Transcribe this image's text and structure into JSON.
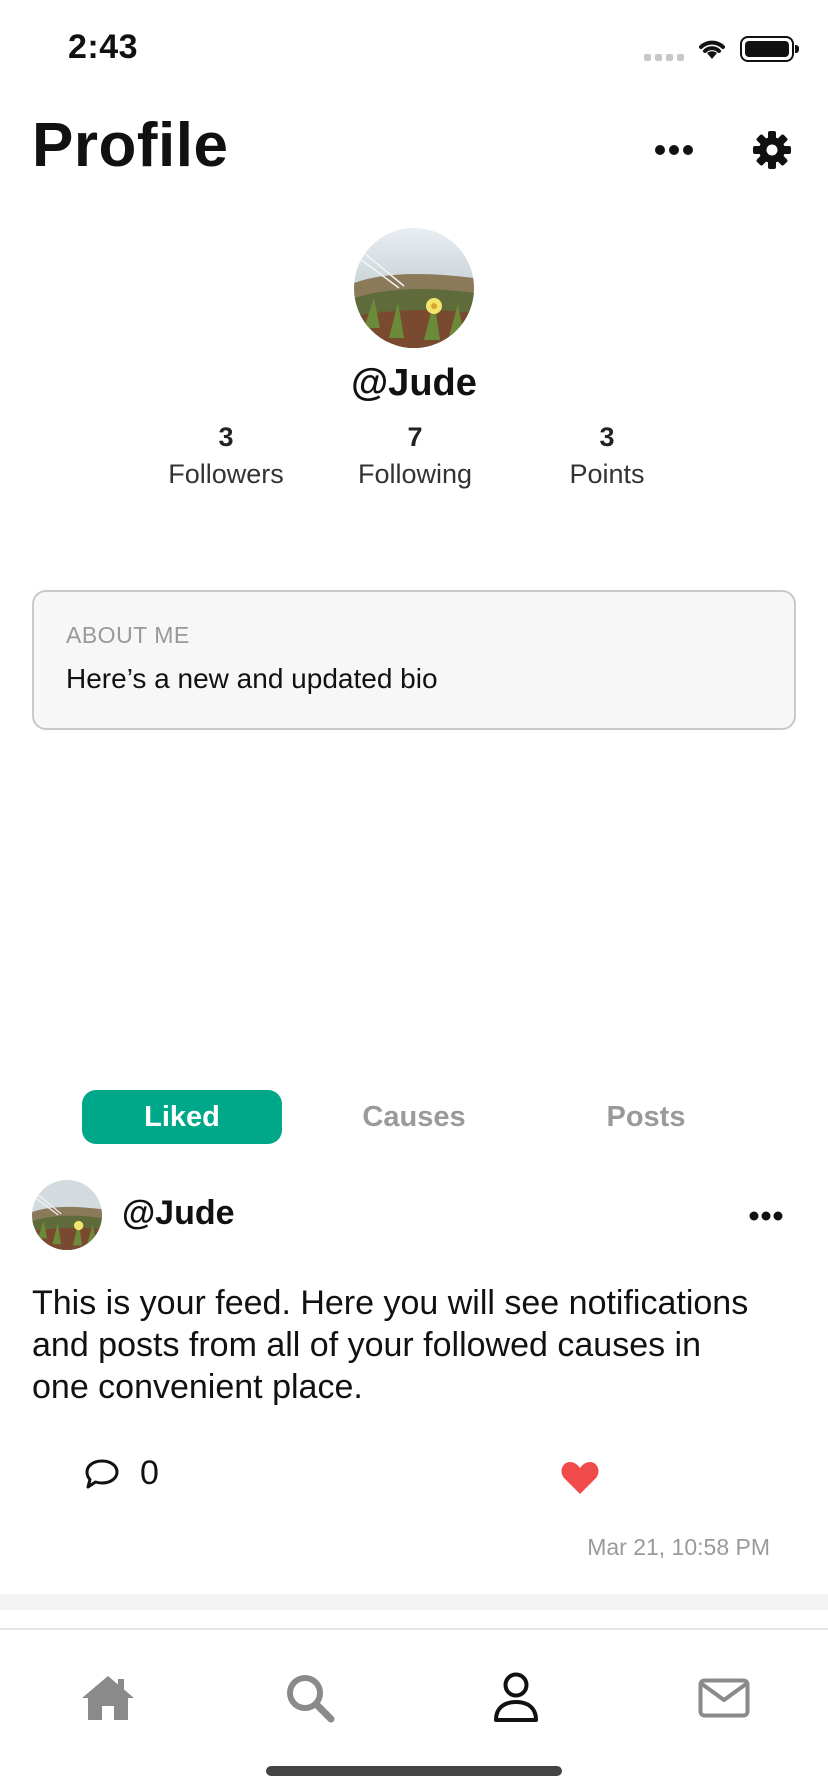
{
  "status_bar": {
    "time": "2:43"
  },
  "header": {
    "title": "Profile"
  },
  "profile": {
    "username": "@Jude",
    "stats": [
      {
        "value": "3",
        "label": "Followers"
      },
      {
        "value": "7",
        "label": "Following"
      },
      {
        "value": "3",
        "label": "Points"
      }
    ]
  },
  "about": {
    "title": "ABOUT ME",
    "text": "Here’s a new and updated bio"
  },
  "tabs": [
    {
      "label": "Liked",
      "active": true
    },
    {
      "label": "Causes",
      "active": false
    },
    {
      "label": "Posts",
      "active": false
    }
  ],
  "post": {
    "username": "@Jude",
    "body": "This is your feed. Here you will see notifications and posts from all of your followed causes in one convenient place.",
    "comment_count": "0",
    "liked": true,
    "timestamp": "Mar 21, 10:58 PM"
  },
  "colors": {
    "accent": "#00a88a",
    "like": "#f04a4a",
    "inactive_tab": "#9a9a9a"
  },
  "icons": {
    "header": [
      "more-icon",
      "gear-icon"
    ],
    "tab_bar": [
      "home-icon",
      "search-icon",
      "profile-icon",
      "mail-icon"
    ]
  }
}
